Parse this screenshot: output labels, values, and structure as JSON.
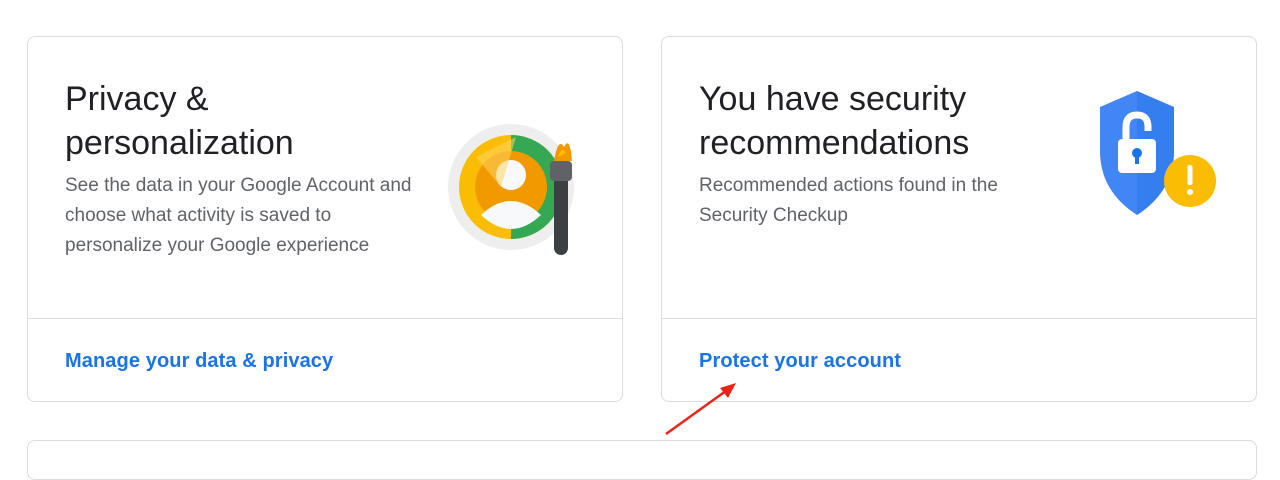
{
  "privacy_card": {
    "title": "Privacy & personalization",
    "description": "See the data in your Google Account and choose what activity is saved to personalize your Google experience",
    "link": "Manage your data & privacy",
    "illustration_icon": "privacy-paintbrush-icon"
  },
  "security_card": {
    "title": "You have security recommendations",
    "description": "Recommended actions found in the Security Checkup",
    "link": "Protect your account",
    "illustration_icon": "shield-lock-warning-icon"
  },
  "annotation": {
    "arrow_color": "#e8241b"
  },
  "colors": {
    "link": "#1a73e8",
    "shield_blue": "#4285f4",
    "warning_yellow": "#fbbc04",
    "green": "#34a853"
  }
}
